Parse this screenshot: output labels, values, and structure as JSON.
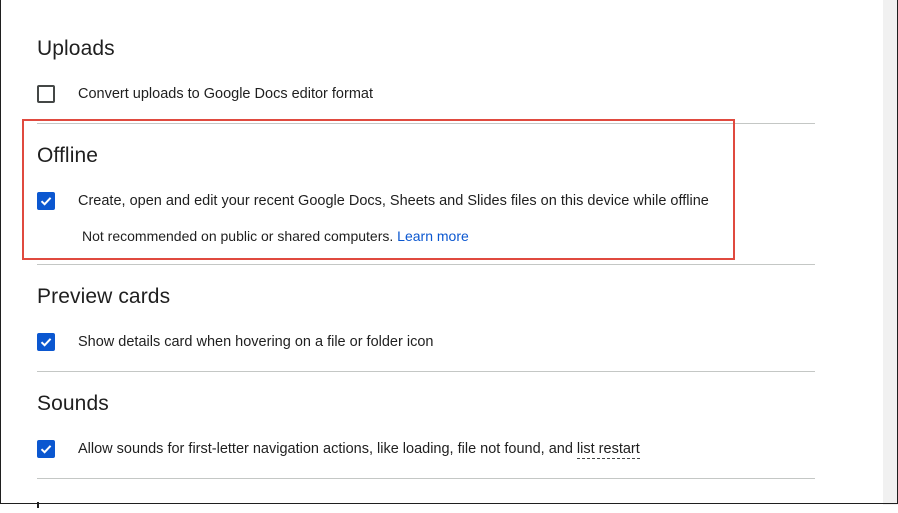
{
  "sections": {
    "uploads": {
      "title": "Uploads",
      "convert_label": "Convert uploads to Google Docs editor format",
      "convert_checked": false
    },
    "offline": {
      "title": "Offline",
      "option_label": "Create, open and edit your recent Google Docs, Sheets and Slides files on this device while offline",
      "option_checked": true,
      "note_text": "Not recommended on public or shared computers.",
      "learn_more": "Learn more"
    },
    "preview_cards": {
      "title": "Preview cards",
      "option_label": "Show details card when hovering on a file or folder icon",
      "option_checked": true
    },
    "sounds": {
      "title": "Sounds",
      "option_label_prefix": "Allow sounds for first-letter navigation actions, like loading, file not found, and",
      "option_label_link": "list restart",
      "option_checked": true
    }
  },
  "colors": {
    "accent": "#0b57d0",
    "highlight_border": "#e04a3f",
    "divider": "#c4c7c5"
  },
  "icons": {
    "checkmark": "check-icon"
  }
}
